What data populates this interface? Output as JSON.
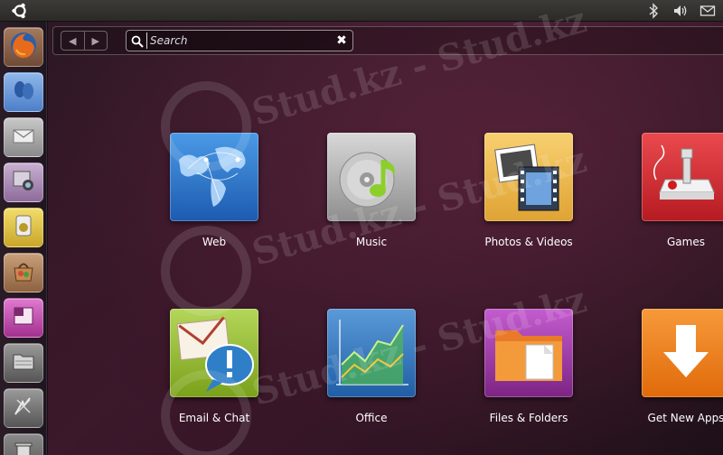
{
  "panel": {
    "logo_icon": "ubuntu-logo-icon",
    "indicators": [
      "bluetooth-icon",
      "volume-icon",
      "mail-icon"
    ]
  },
  "launcher": {
    "items": [
      {
        "name": "firefox",
        "icon": "firefox-icon",
        "color": "#c9622b"
      },
      {
        "name": "empathy",
        "icon": "empathy-icon",
        "color": "#5b8fd6"
      },
      {
        "name": "evolution",
        "icon": "evolution-icon",
        "color": "#8f8f8f"
      },
      {
        "name": "cheese",
        "icon": "webcam-icon",
        "color": "#9c7fa6"
      },
      {
        "name": "banshee",
        "icon": "media-player-icon",
        "color": "#d8b838"
      },
      {
        "name": "software-center",
        "icon": "software-center-icon",
        "color": "#a87a4f"
      },
      {
        "name": "workspaces",
        "icon": "workspace-switcher-icon",
        "color": "#b23a9a"
      },
      {
        "name": "files",
        "icon": "folder-icon",
        "color": "#6e6e6e"
      },
      {
        "name": "applications",
        "icon": "applications-icon",
        "color": "#7a7a7a"
      },
      {
        "name": "trash",
        "icon": "trash-icon",
        "color": "#6a6a6a"
      }
    ]
  },
  "dash": {
    "back_icon": "back-arrow-icon",
    "forward_icon": "forward-arrow-icon",
    "search": {
      "placeholder": "Search",
      "value": ""
    },
    "categories": [
      {
        "label": "Web",
        "icon": "web-globe-icon",
        "color": "#2f74c8"
      },
      {
        "label": "Music",
        "icon": "music-disc-icon",
        "color": "#9a9a9a"
      },
      {
        "label": "Photos & Videos",
        "icon": "photos-videos-icon",
        "color": "#e9b547"
      },
      {
        "label": "Games",
        "icon": "joystick-icon",
        "color": "#c8282d"
      },
      {
        "label": "Email & Chat",
        "icon": "email-chat-icon",
        "color": "#8bb322"
      },
      {
        "label": "Office",
        "icon": "office-chart-icon",
        "color": "#2e6fb0"
      },
      {
        "label": "Files & Folders",
        "icon": "files-folders-icon",
        "color": "#9b3aa6"
      },
      {
        "label": "Get New Apps",
        "icon": "download-arrow-icon",
        "color": "#ec7c15"
      }
    ]
  },
  "watermark": {
    "text": "Stud.kz - Stud.kz"
  }
}
